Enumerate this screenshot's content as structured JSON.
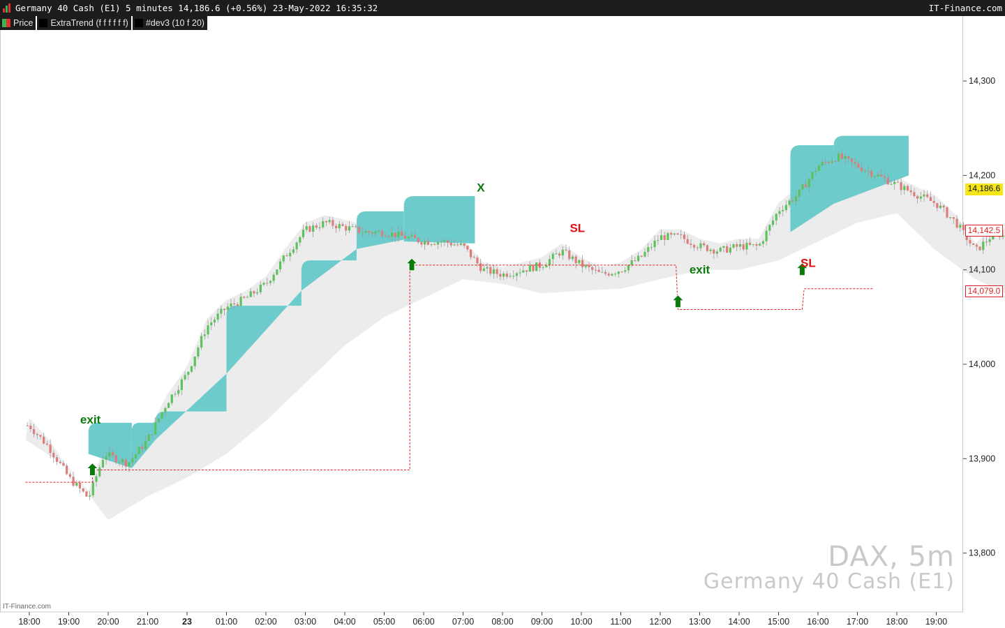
{
  "header": {
    "title": "Germany 40 Cash (E1) 5 minutes 14,186.6 (+0.56%) 23-May-2022 16:35:32",
    "brand": "IT-Finance.com"
  },
  "legend": [
    {
      "label": "Price",
      "color": "#3cb44b"
    },
    {
      "label": "ExtraTrend (f f f f f f)",
      "color": "#000000"
    },
    {
      "label": "#dev3 (10 f 20)",
      "color": "#000000"
    }
  ],
  "price_labels": {
    "last": "14,186.6",
    "upper": "14,142.5",
    "lower": "14,079.0"
  },
  "watermark": {
    "symbol": "DAX, 5m",
    "name": "Germany 40 Cash (E1)"
  },
  "footer_brand": "IT-Finance.com",
  "colors": {
    "bull": "#5cc25c",
    "bear": "#e07b7b",
    "band_upper": "#6ecbcb",
    "band_lower": "#ececec",
    "stop_line": "#e02020",
    "arrow": "#0a7a0a",
    "last_price_bg": "#f5e61a"
  },
  "chart_data": {
    "type": "candlestick",
    "title": "",
    "y_ticks": [
      13800,
      13900,
      14000,
      14100,
      14200,
      14300
    ],
    "y_tick_labels": [
      "13,800",
      "13,900",
      "14,000",
      "14,100",
      "14,200",
      "14,300"
    ],
    "ylim": [
      13750,
      14350
    ],
    "x_ticks": [
      "18:00",
      "19:00",
      "20:00",
      "21:00",
      "23",
      "01:00",
      "02:00",
      "03:00",
      "04:00",
      "05:00",
      "06:00",
      "07:00",
      "08:00",
      "09:00",
      "10:00",
      "11:00",
      "12:00",
      "13:00",
      "14:00",
      "15:00",
      "16:00",
      "17:00",
      "18:00",
      "19:00"
    ],
    "grid": false,
    "price_path": [
      [
        0,
        13935
      ],
      [
        0.5,
        13912
      ],
      [
        1,
        13880
      ],
      [
        1.5,
        13858
      ],
      [
        1.9,
        13905
      ],
      [
        2.5,
        13895
      ],
      [
        3,
        13920
      ],
      [
        3.5,
        13960
      ],
      [
        4,
        13990
      ],
      [
        4.5,
        14040
      ],
      [
        5,
        14060
      ],
      [
        5.5,
        14070
      ],
      [
        6,
        14085
      ],
      [
        6.5,
        14115
      ],
      [
        7,
        14142
      ],
      [
        7.5,
        14150
      ],
      [
        8,
        14145
      ],
      [
        8.5,
        14140
      ],
      [
        9,
        14140
      ],
      [
        9.5,
        14135
      ],
      [
        10,
        14130
      ],
      [
        10.5,
        14130
      ],
      [
        11,
        14125
      ],
      [
        11.5,
        14100
      ],
      [
        12,
        14095
      ],
      [
        12.5,
        14100
      ],
      [
        13,
        14105
      ],
      [
        13.5,
        14120
      ],
      [
        14,
        14105
      ],
      [
        14.5,
        14095
      ],
      [
        15,
        14100
      ],
      [
        15.5,
        14113
      ],
      [
        16,
        14135
      ],
      [
        16.5,
        14135
      ],
      [
        17,
        14125
      ],
      [
        17.5,
        14120
      ],
      [
        18,
        14125
      ],
      [
        18.5,
        14125
      ],
      [
        19,
        14163
      ],
      [
        19.5,
        14180
      ],
      [
        20,
        14210
      ],
      [
        20.5,
        14220
      ],
      [
        21,
        14210
      ],
      [
        21.5,
        14200
      ],
      [
        22,
        14190
      ],
      [
        22.5,
        14180
      ],
      [
        23,
        14170
      ],
      [
        23.5,
        14150
      ],
      [
        24,
        14120
      ],
      [
        24.5,
        14140
      ],
      [
        25,
        14130
      ],
      [
        25.5,
        14100
      ],
      [
        26,
        14080
      ],
      [
        26.5,
        14075
      ],
      [
        27,
        14068
      ],
      [
        27.5,
        14060
      ],
      [
        28,
        14050
      ],
      [
        28.5,
        14056
      ],
      [
        29,
        14062
      ],
      [
        29.5,
        14050
      ],
      [
        30,
        14045
      ],
      [
        30.5,
        14050
      ],
      [
        31,
        14058
      ],
      [
        31.5,
        14066
      ],
      [
        32,
        14065
      ],
      [
        32.5,
        14080
      ],
      [
        33,
        14105
      ],
      [
        33.5,
        14120
      ],
      [
        34,
        14100
      ],
      [
        34.5,
        14080
      ],
      [
        35,
        14085
      ],
      [
        35.5,
        14095
      ],
      [
        36,
        14090
      ],
      [
        36.5,
        14100
      ],
      [
        37,
        14080
      ],
      [
        37.5,
        14085
      ],
      [
        38,
        14080
      ],
      [
        38.5,
        14090
      ],
      [
        39,
        14075
      ],
      [
        39.5,
        14090
      ],
      [
        40,
        14080
      ],
      [
        40.5,
        14085
      ],
      [
        41,
        14105
      ],
      [
        41.5,
        14125
      ],
      [
        42,
        14120
      ],
      [
        42.5,
        14125
      ],
      [
        43,
        14112
      ],
      [
        43.5,
        14135
      ],
      [
        44,
        14140
      ],
      [
        44.5,
        14150
      ],
      [
        45,
        14157
      ],
      [
        45.5,
        14160
      ],
      [
        45.9,
        14186.6
      ]
    ],
    "upper_band_segments": [
      {
        "x": [
          1.5,
          2.6
        ],
        "top": 13938,
        "base": [
          13905,
          13890
        ]
      },
      {
        "x": [
          2.6,
          3.2
        ],
        "top": 13938,
        "base": [
          13890,
          13920
        ]
      },
      {
        "x": [
          3.2,
          5.0
        ],
        "top": 13950,
        "base": [
          13920,
          13990
        ]
      },
      {
        "x": [
          5.0,
          6.9
        ],
        "top": 14062,
        "base": [
          13990,
          14078
        ]
      },
      {
        "x": [
          6.9,
          8.3
        ],
        "top": 14110,
        "base": [
          14078,
          14122
        ]
      },
      {
        "x": [
          8.3,
          9.5
        ],
        "top": 14162,
        "base": [
          14122,
          14132
        ]
      },
      {
        "x": [
          9.5,
          11.3
        ],
        "top": 14178,
        "base": [
          14130,
          14128
        ]
      },
      {
        "x": [
          19.3,
          20.4
        ],
        "top": 14232,
        "base": [
          14140,
          14170
        ]
      },
      {
        "x": [
          20.4,
          22.3
        ],
        "top": 14242,
        "base": [
          14170,
          14200
        ]
      },
      {
        "x": [
          33.0,
          36.5
        ],
        "top": 14132,
        "base": [
          14085,
          14105
        ]
      },
      {
        "x": [
          39.5,
          45.5
        ],
        "top": 14140,
        "base": [
          14095,
          14140
        ]
      }
    ],
    "lower_band": [
      [
        -0.1,
        13920
      ],
      [
        1,
        13890
      ],
      [
        2,
        13835
      ],
      [
        3,
        13860
      ],
      [
        4,
        13880
      ],
      [
        5,
        13905
      ],
      [
        6,
        13940
      ],
      [
        7,
        13980
      ],
      [
        8,
        14020
      ],
      [
        9,
        14050
      ],
      [
        10,
        14070
      ],
      [
        11,
        14090
      ],
      [
        12,
        14085
      ],
      [
        13,
        14075
      ],
      [
        14,
        14078
      ],
      [
        15,
        14080
      ],
      [
        16,
        14090
      ],
      [
        17,
        14100
      ],
      [
        18,
        14100
      ],
      [
        19,
        14110
      ],
      [
        20,
        14130
      ],
      [
        21,
        14150
      ],
      [
        22,
        14160
      ],
      [
        23,
        14120
      ],
      [
        24,
        14090
      ],
      [
        25,
        14070
      ],
      [
        26,
        14050
      ],
      [
        27,
        14035
      ],
      [
        28,
        14025
      ],
      [
        29,
        14030
      ],
      [
        30,
        14025
      ],
      [
        31,
        14030
      ],
      [
        32,
        14040
      ],
      [
        33,
        14050
      ],
      [
        34,
        14055
      ],
      [
        35,
        14060
      ],
      [
        36,
        14060
      ],
      [
        37,
        14055
      ],
      [
        38,
        14055
      ],
      [
        39,
        14058
      ],
      [
        40,
        14060
      ],
      [
        41,
        14065
      ],
      [
        42,
        14065
      ],
      [
        43,
        14070
      ],
      [
        44,
        14075
      ],
      [
        45,
        14085
      ],
      [
        46,
        14100
      ]
    ],
    "stop_line": [
      [
        -0.1,
        13875
      ],
      [
        1.6,
        13875
      ],
      [
        1.6,
        13888
      ],
      [
        9.65,
        13888
      ],
      [
        9.65,
        14105
      ],
      [
        16.4,
        14105
      ],
      [
        16.4,
        14105
      ],
      [
        16.45,
        14058
      ],
      [
        19.6,
        14058
      ],
      [
        19.65,
        14080
      ],
      [
        21.4,
        14080
      ]
    ],
    "buy_arrows": [
      [
        1.6,
        13888
      ],
      [
        9.7,
        14105
      ],
      [
        16.45,
        14066
      ],
      [
        19.6,
        14100
      ]
    ],
    "annotations": [
      {
        "text": "exit",
        "x": 1.55,
        "y": 13937,
        "color": "green"
      },
      {
        "text": "X",
        "x": 11.45,
        "y": 14183,
        "color": "green"
      },
      {
        "text": "SL",
        "x": 13.9,
        "y": 14140,
        "color": "red"
      },
      {
        "text": "exit",
        "x": 17.0,
        "y": 14096,
        "color": "green"
      },
      {
        "text": "SL",
        "x": 19.75,
        "y": 14103,
        "color": "red"
      }
    ]
  }
}
